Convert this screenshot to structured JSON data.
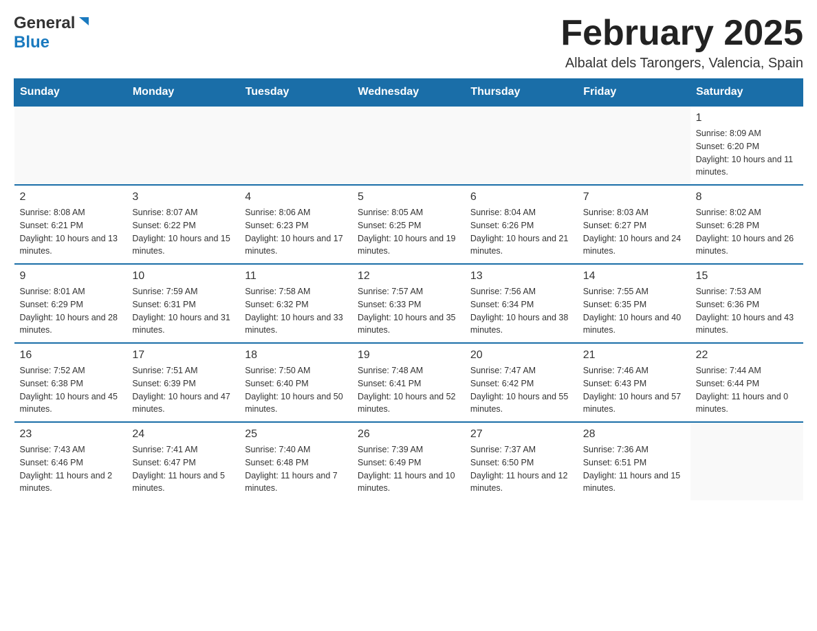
{
  "header": {
    "title": "February 2025",
    "subtitle": "Albalat dels Tarongers, Valencia, Spain",
    "logo_general": "General",
    "logo_blue": "Blue"
  },
  "days_of_week": [
    "Sunday",
    "Monday",
    "Tuesday",
    "Wednesday",
    "Thursday",
    "Friday",
    "Saturday"
  ],
  "weeks": [
    [
      {
        "day": "",
        "info": ""
      },
      {
        "day": "",
        "info": ""
      },
      {
        "day": "",
        "info": ""
      },
      {
        "day": "",
        "info": ""
      },
      {
        "day": "",
        "info": ""
      },
      {
        "day": "",
        "info": ""
      },
      {
        "day": "1",
        "info": "Sunrise: 8:09 AM\nSunset: 6:20 PM\nDaylight: 10 hours and 11 minutes."
      }
    ],
    [
      {
        "day": "2",
        "info": "Sunrise: 8:08 AM\nSunset: 6:21 PM\nDaylight: 10 hours and 13 minutes."
      },
      {
        "day": "3",
        "info": "Sunrise: 8:07 AM\nSunset: 6:22 PM\nDaylight: 10 hours and 15 minutes."
      },
      {
        "day": "4",
        "info": "Sunrise: 8:06 AM\nSunset: 6:23 PM\nDaylight: 10 hours and 17 minutes."
      },
      {
        "day": "5",
        "info": "Sunrise: 8:05 AM\nSunset: 6:25 PM\nDaylight: 10 hours and 19 minutes."
      },
      {
        "day": "6",
        "info": "Sunrise: 8:04 AM\nSunset: 6:26 PM\nDaylight: 10 hours and 21 minutes."
      },
      {
        "day": "7",
        "info": "Sunrise: 8:03 AM\nSunset: 6:27 PM\nDaylight: 10 hours and 24 minutes."
      },
      {
        "day": "8",
        "info": "Sunrise: 8:02 AM\nSunset: 6:28 PM\nDaylight: 10 hours and 26 minutes."
      }
    ],
    [
      {
        "day": "9",
        "info": "Sunrise: 8:01 AM\nSunset: 6:29 PM\nDaylight: 10 hours and 28 minutes."
      },
      {
        "day": "10",
        "info": "Sunrise: 7:59 AM\nSunset: 6:31 PM\nDaylight: 10 hours and 31 minutes."
      },
      {
        "day": "11",
        "info": "Sunrise: 7:58 AM\nSunset: 6:32 PM\nDaylight: 10 hours and 33 minutes."
      },
      {
        "day": "12",
        "info": "Sunrise: 7:57 AM\nSunset: 6:33 PM\nDaylight: 10 hours and 35 minutes."
      },
      {
        "day": "13",
        "info": "Sunrise: 7:56 AM\nSunset: 6:34 PM\nDaylight: 10 hours and 38 minutes."
      },
      {
        "day": "14",
        "info": "Sunrise: 7:55 AM\nSunset: 6:35 PM\nDaylight: 10 hours and 40 minutes."
      },
      {
        "day": "15",
        "info": "Sunrise: 7:53 AM\nSunset: 6:36 PM\nDaylight: 10 hours and 43 minutes."
      }
    ],
    [
      {
        "day": "16",
        "info": "Sunrise: 7:52 AM\nSunset: 6:38 PM\nDaylight: 10 hours and 45 minutes."
      },
      {
        "day": "17",
        "info": "Sunrise: 7:51 AM\nSunset: 6:39 PM\nDaylight: 10 hours and 47 minutes."
      },
      {
        "day": "18",
        "info": "Sunrise: 7:50 AM\nSunset: 6:40 PM\nDaylight: 10 hours and 50 minutes."
      },
      {
        "day": "19",
        "info": "Sunrise: 7:48 AM\nSunset: 6:41 PM\nDaylight: 10 hours and 52 minutes."
      },
      {
        "day": "20",
        "info": "Sunrise: 7:47 AM\nSunset: 6:42 PM\nDaylight: 10 hours and 55 minutes."
      },
      {
        "day": "21",
        "info": "Sunrise: 7:46 AM\nSunset: 6:43 PM\nDaylight: 10 hours and 57 minutes."
      },
      {
        "day": "22",
        "info": "Sunrise: 7:44 AM\nSunset: 6:44 PM\nDaylight: 11 hours and 0 minutes."
      }
    ],
    [
      {
        "day": "23",
        "info": "Sunrise: 7:43 AM\nSunset: 6:46 PM\nDaylight: 11 hours and 2 minutes."
      },
      {
        "day": "24",
        "info": "Sunrise: 7:41 AM\nSunset: 6:47 PM\nDaylight: 11 hours and 5 minutes."
      },
      {
        "day": "25",
        "info": "Sunrise: 7:40 AM\nSunset: 6:48 PM\nDaylight: 11 hours and 7 minutes."
      },
      {
        "day": "26",
        "info": "Sunrise: 7:39 AM\nSunset: 6:49 PM\nDaylight: 11 hours and 10 minutes."
      },
      {
        "day": "27",
        "info": "Sunrise: 7:37 AM\nSunset: 6:50 PM\nDaylight: 11 hours and 12 minutes."
      },
      {
        "day": "28",
        "info": "Sunrise: 7:36 AM\nSunset: 6:51 PM\nDaylight: 11 hours and 15 minutes."
      },
      {
        "day": "",
        "info": ""
      }
    ]
  ]
}
